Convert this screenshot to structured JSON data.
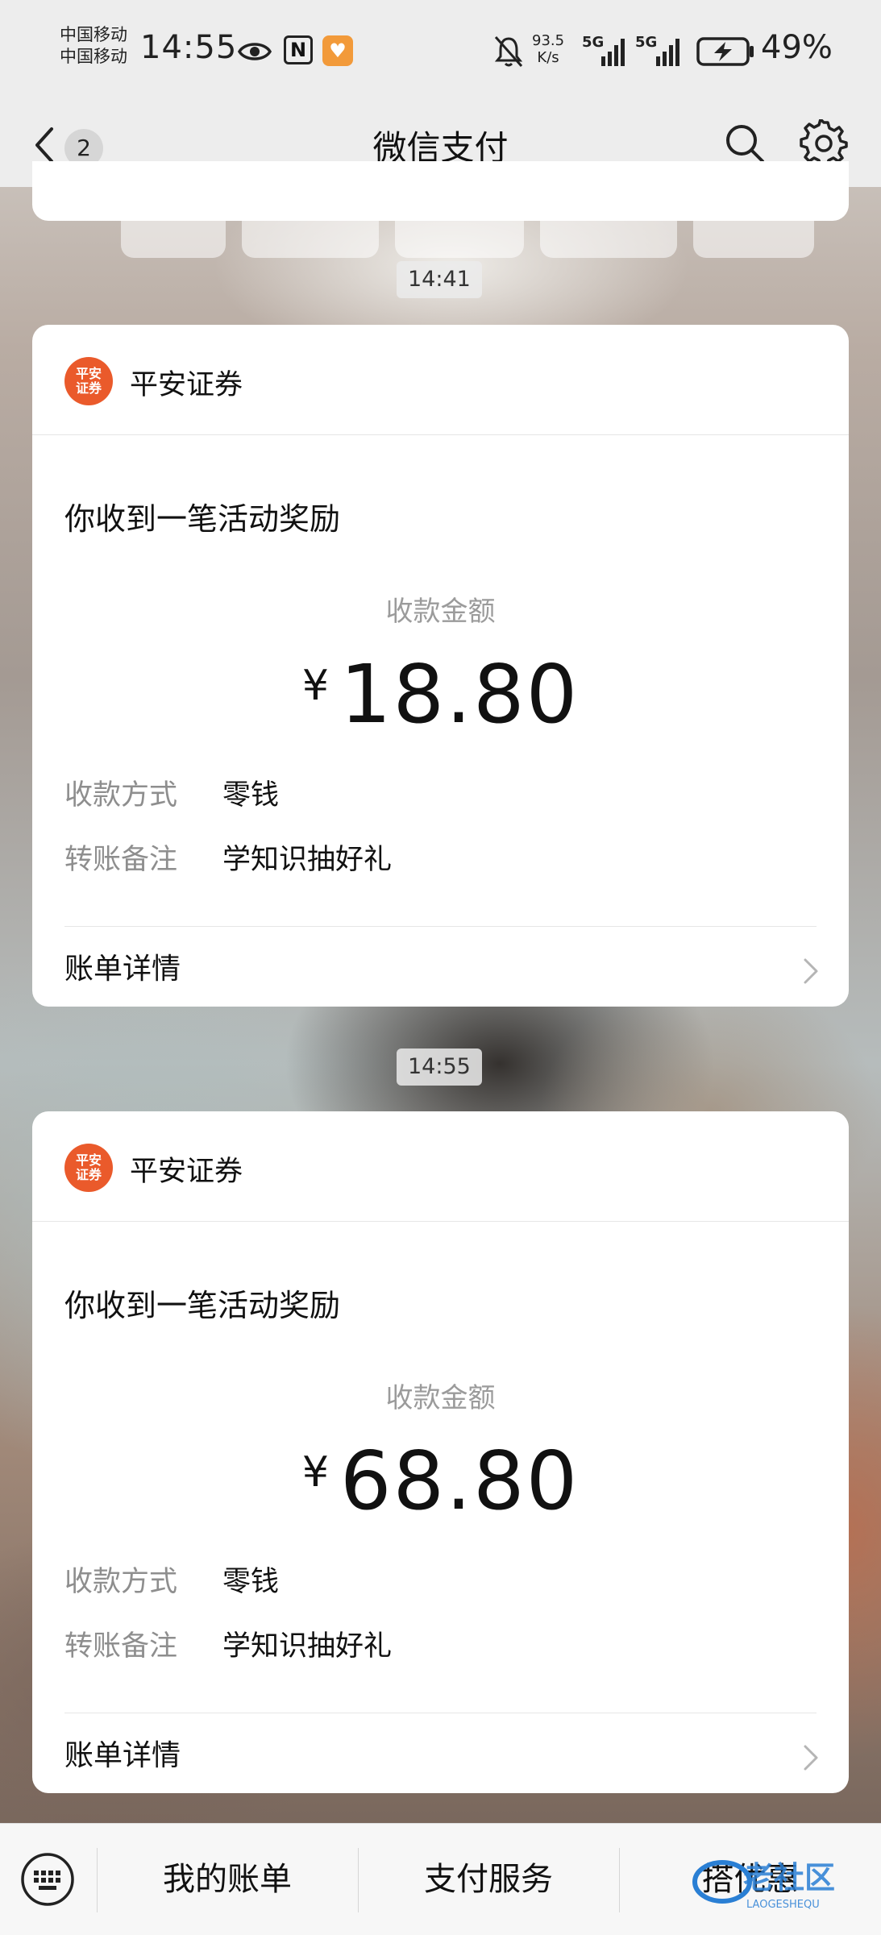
{
  "status_bar": {
    "carrier_1": "中国移动",
    "carrier_2": "中国移动",
    "time": "14:55",
    "speed_value": "93.5",
    "speed_unit": "K/s",
    "network_1": "5G",
    "network_2": "5G",
    "battery": "49%"
  },
  "header": {
    "back_count": "2",
    "title": "微信支付"
  },
  "messages": [
    {
      "time": "14:41",
      "sender": "平安证券",
      "logo_text": "平安证券",
      "headline": "你收到一笔活动奖励",
      "amount_label": "收款金额",
      "currency": "¥",
      "amount": "18.80",
      "method_label": "收款方式",
      "method_value": "零钱",
      "note_label": "转账备注",
      "note_value": "学知识抽好礼",
      "detail_label": "账单详情"
    },
    {
      "time": "14:55",
      "sender": "平安证券",
      "logo_text": "平安证券",
      "headline": "你收到一笔活动奖励",
      "amount_label": "收款金额",
      "currency": "¥",
      "amount": "68.80",
      "method_label": "收款方式",
      "method_value": "零钱",
      "note_label": "转账备注",
      "note_value": "学知识抽好礼",
      "detail_label": "账单详情"
    }
  ],
  "bottom_menu": {
    "items": [
      "我的账单",
      "支付服务",
      "搭优惠"
    ]
  },
  "watermark": {
    "main": "老社区",
    "sub": "LAOGESHEQU"
  },
  "colors": {
    "brand_logo": "#ea5a2b",
    "bar_bg": "#ededed",
    "muted_text": "#9b9b9b"
  }
}
